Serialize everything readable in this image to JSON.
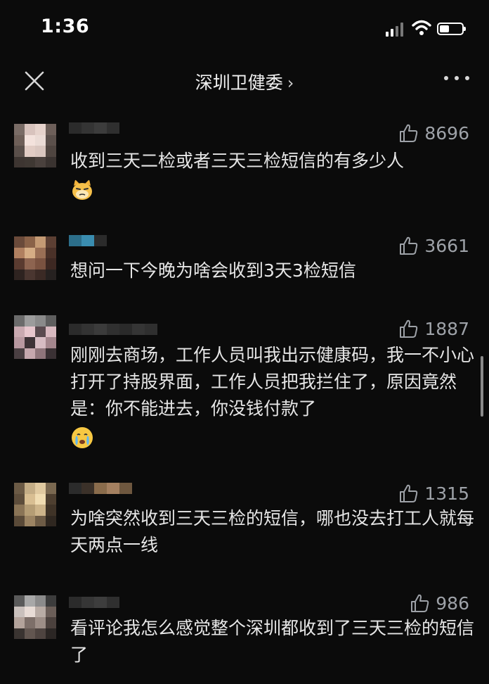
{
  "status": {
    "time": "1:36"
  },
  "header": {
    "title": "深圳卫健委",
    "chevron": "›"
  },
  "icons": {
    "close": "close-icon",
    "more": "more-icon",
    "like": "thumbs-up-icon",
    "signal": "cellular-signal-icon",
    "wifi": "wifi-icon",
    "battery": "battery-icon"
  },
  "comments": [
    {
      "likes": "8696",
      "text": "收到三天二检或者三天三检短信的有多少人",
      "emoji": "cat-emoji"
    },
    {
      "likes": "3661",
      "text": "想问一下今晚为啥会收到3天3检短信"
    },
    {
      "likes": "1887",
      "text": "刚刚去商场，工作人员叫我出示健康码，我一不小心打开了持股界面，工作人员把我拦住了，原因竟然是：你不能进去，你没钱付款了",
      "emoji": "crying-face-emoji"
    },
    {
      "likes": "1315",
      "text": "为啥突然收到三天三检的短信，哪也没去打工人就每天两点一线"
    },
    {
      "likes": "986",
      "text": "看评论我怎么感觉整个深圳都收到了三天三检的短信了"
    }
  ]
}
